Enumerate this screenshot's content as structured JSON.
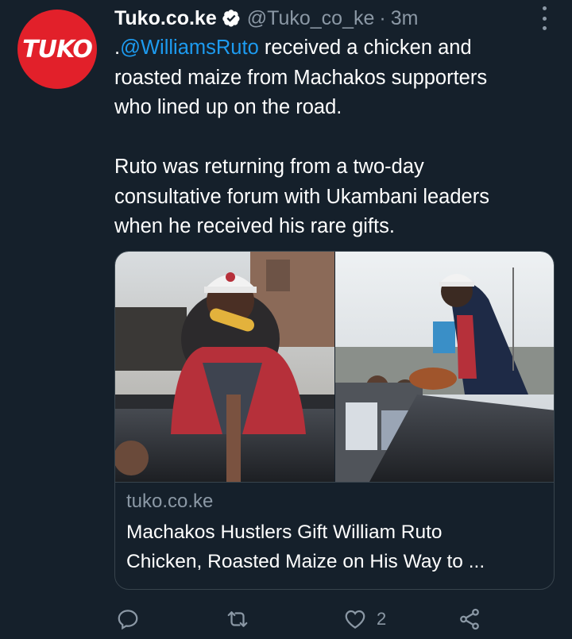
{
  "tweet": {
    "avatar_text": "TUKO",
    "author_name": "Tuko.co.ke",
    "handle": "@Tuko_co_ke",
    "separator": "·",
    "time": "3m",
    "mention": "@WilliamsRuto",
    "text_prefix": ".",
    "text_line1_rest": " received a chicken and",
    "text_line2": "roasted maize from Machakos supporters",
    "text_line3": "who lined up on the road.",
    "para2_line1": "Ruto was returning from a two-day",
    "para2_line2": "consultative forum with Ukambani leaders",
    "para2_line3": "when he received his rare gifts."
  },
  "card": {
    "domain": "tuko.co.ke",
    "title_line1": "Machakos Hustlers Gift William Ruto",
    "title_line2": "Chicken, Roasted Maize on His Way to ..."
  },
  "actions": {
    "reply_count": "",
    "retweet_count": "",
    "like_count": "2"
  },
  "colors": {
    "background": "#15202b",
    "accent": "#1d9bf0",
    "muted": "#8b98a5",
    "avatar": "#e2202a"
  }
}
